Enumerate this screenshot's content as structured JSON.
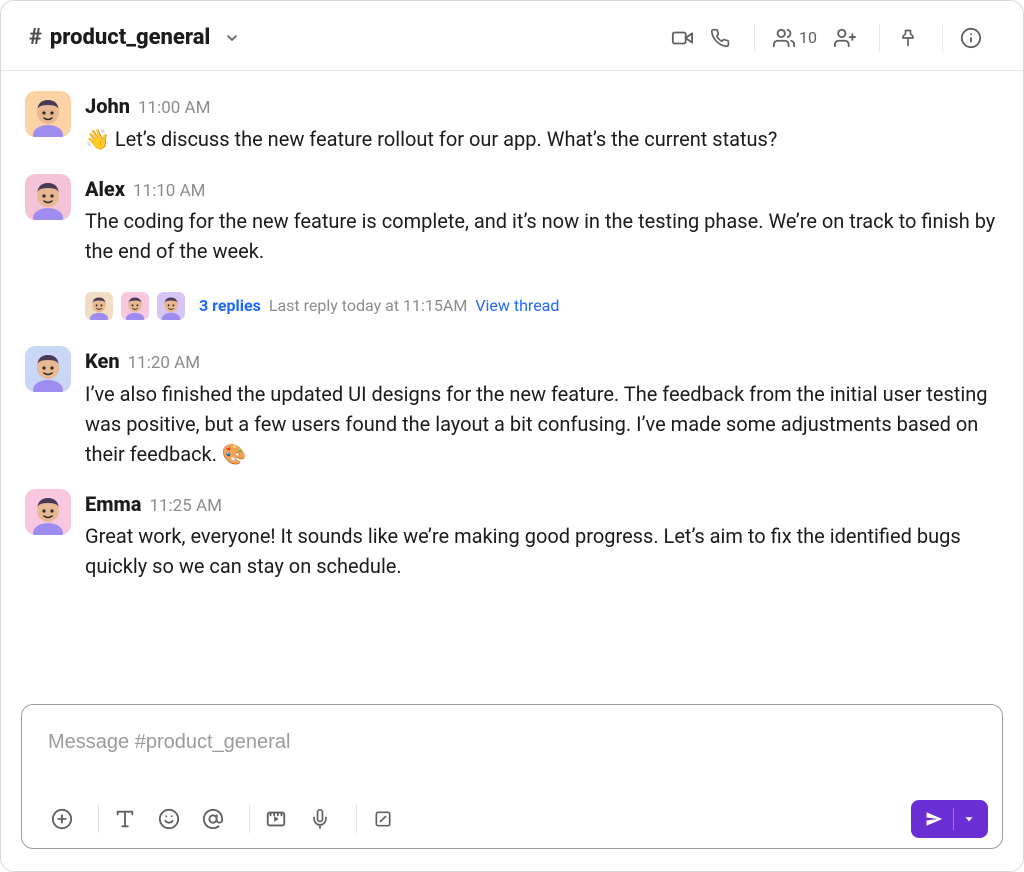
{
  "header": {
    "channel_prefix": "#",
    "channel_name": "product_general",
    "members_count": "10"
  },
  "avatarColors": {
    "orange": "#fcd3a4",
    "pink1": "#f4c3d8",
    "blue": "#c9d6f6",
    "pink2": "#f9c8e0",
    "sand": "#f0ddc4",
    "lilac": "#d7c6f3"
  },
  "messages": [
    {
      "sender": "John",
      "time": "11:00 AM",
      "avatar_bg": "orange",
      "text": "👋 Let’s discuss the new feature rollout for our app. What’s the current status?"
    },
    {
      "sender": "Alex",
      "time": "11:10 AM",
      "avatar_bg": "pink1",
      "text": "The coding for the new feature is complete, and it’s now in the testing phase. We’re on track to finish by the end of the week.",
      "thread": {
        "avatars": [
          "sand",
          "pink2",
          "lilac"
        ],
        "replies_label": "3 replies",
        "last_reply_label": "Last reply today at 11:15AM",
        "view_thread_label": "View thread"
      }
    },
    {
      "sender": "Ken",
      "time": "11:20 AM",
      "avatar_bg": "blue",
      "text": "I’ve also finished the updated UI designs for the new feature. The feedback from the initial user testing was positive, but a few users found the layout a bit confusing. I’ve made some adjustments based on their feedback. 🎨"
    },
    {
      "sender": "Emma",
      "time": "11:25 AM",
      "avatar_bg": "pink2",
      "text": "Great work, everyone! It sounds like we’re making good progress. Let’s aim to fix the identified bugs quickly so we can stay on schedule."
    }
  ],
  "composer": {
    "placeholder": "Message #product_general"
  }
}
